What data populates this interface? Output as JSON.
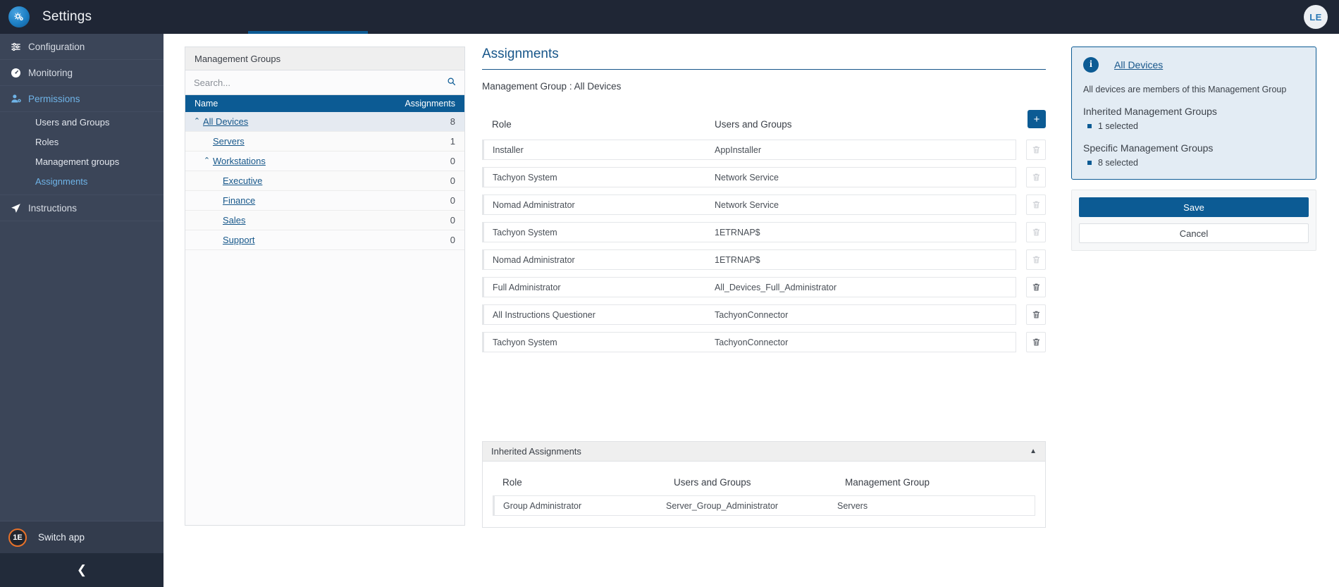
{
  "app": {
    "title": "Settings",
    "logo_icon": "gears-logo-icon",
    "avatar_initials": "LE"
  },
  "sidebar": {
    "items": [
      {
        "label": "Configuration",
        "icon": "sliders-icon",
        "active": false
      },
      {
        "label": "Monitoring",
        "icon": "gauge-icon",
        "active": false
      },
      {
        "label": "Permissions",
        "icon": "user-gear-icon",
        "active": true
      }
    ],
    "sub_items": [
      {
        "label": "Users and Groups",
        "active": false
      },
      {
        "label": "Roles",
        "active": false
      },
      {
        "label": "Management groups",
        "active": false
      },
      {
        "label": "Assignments",
        "active": true
      }
    ],
    "instructions": {
      "label": "Instructions",
      "icon": "paper-plane-icon"
    },
    "switch_app": {
      "label": "Switch app",
      "logo_text": "1E"
    },
    "collapse_icon": "chevron-left-icon"
  },
  "management_groups": {
    "panel_title": "Management Groups",
    "search_placeholder": "Search...",
    "search_value": "",
    "search_icon": "search-icon",
    "columns": {
      "name": "Name",
      "assignments": "Assignments"
    },
    "rows": [
      {
        "name": "All Devices",
        "assignments": "8",
        "indent": 0,
        "caret": "up",
        "selected": true
      },
      {
        "name": "Servers",
        "assignments": "1",
        "indent": 1,
        "caret": "",
        "selected": false
      },
      {
        "name": "Workstations",
        "assignments": "0",
        "indent": 1,
        "caret": "up",
        "selected": false
      },
      {
        "name": "Executive",
        "assignments": "0",
        "indent": 2,
        "caret": "",
        "selected": false
      },
      {
        "name": "Finance",
        "assignments": "0",
        "indent": 2,
        "caret": "",
        "selected": false
      },
      {
        "name": "Sales",
        "assignments": "0",
        "indent": 2,
        "caret": "",
        "selected": false
      },
      {
        "name": "Support",
        "assignments": "0",
        "indent": 2,
        "caret": "",
        "selected": false
      }
    ]
  },
  "assignments": {
    "title": "Assignments",
    "subtitle": "Management Group : All Devices",
    "add_button_label": "+",
    "columns": {
      "role": "Role",
      "users": "Users and Groups"
    },
    "rows": [
      {
        "role": "Installer",
        "users": "AppInstaller",
        "delete_enabled": false
      },
      {
        "role": "Tachyon System",
        "users": "Network Service",
        "delete_enabled": false
      },
      {
        "role": "Nomad Administrator",
        "users": "Network Service",
        "delete_enabled": false
      },
      {
        "role": "Tachyon System",
        "users": "1ETRNAP$",
        "delete_enabled": false
      },
      {
        "role": "Nomad Administrator",
        "users": "1ETRNAP$",
        "delete_enabled": false
      },
      {
        "role": "Full Administrator",
        "users": "All_Devices_Full_Administrator",
        "delete_enabled": true
      },
      {
        "role": "All Instructions Questioner",
        "users": "TachyonConnector",
        "delete_enabled": true
      },
      {
        "role": "Tachyon System",
        "users": "TachyonConnector",
        "delete_enabled": true
      }
    ]
  },
  "inherited": {
    "title": "Inherited Assignments",
    "collapse_icon": "chevron-up-icon",
    "columns": {
      "role": "Role",
      "users": "Users and Groups",
      "group": "Management Group"
    },
    "rows": [
      {
        "role": "Group Administrator",
        "users": "Server_Group_Administrator",
        "group": "Servers"
      }
    ]
  },
  "info_panel": {
    "icon": "info-icon",
    "title": "All Devices",
    "description": "All devices are members of this Management Group",
    "section_inherited": "Inherited Management Groups",
    "inherited_value": "1 selected",
    "section_specific": "Specific Management Groups",
    "specific_value": "8 selected",
    "save_label": "Save",
    "cancel_label": "Cancel"
  },
  "colors": {
    "accent": "#0c5b94",
    "nav_bg": "#3b4558",
    "topbar_bg": "#1f2635",
    "link": "#16578a",
    "info_bg": "#e3ecf4"
  }
}
